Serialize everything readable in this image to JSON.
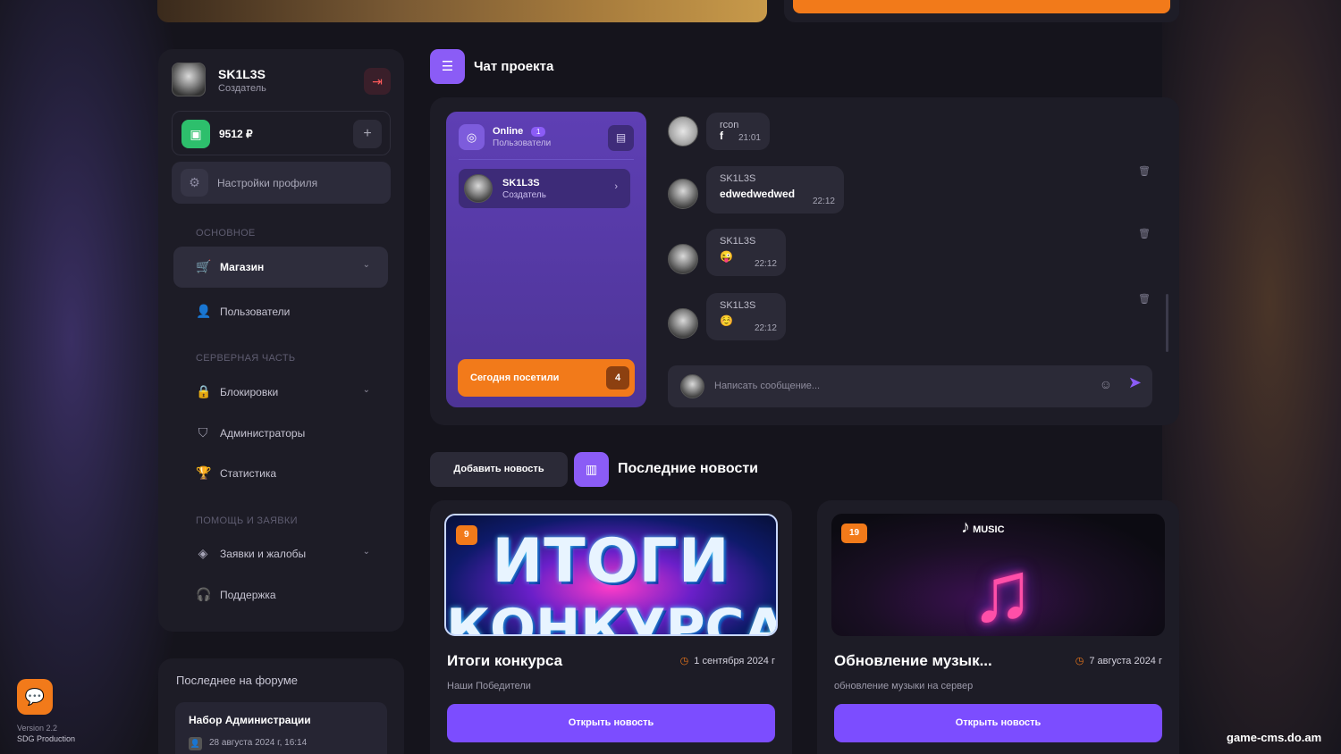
{
  "sidebar": {
    "user": {
      "name": "SK1L3S",
      "role": "Создатель"
    },
    "balance": "9512 ₽",
    "settings_label": "Настройки профиля",
    "sections": [
      {
        "title": "ОСНОВНОЕ"
      },
      {
        "title": "СЕРВЕРНАЯ ЧАСТЬ"
      },
      {
        "title": "ПОМОЩЬ И ЗАЯВКИ"
      }
    ],
    "items": [
      {
        "label": "Магазин",
        "icon": "cart-icon",
        "active": true
      },
      {
        "label": "Пользователи",
        "icon": "user-icon"
      },
      {
        "label": "Блокировки",
        "icon": "lock-icon"
      },
      {
        "label": "Администраторы",
        "icon": "shield-icon"
      },
      {
        "label": "Статистика",
        "icon": "trophy-icon"
      },
      {
        "label": "Заявки и жалобы",
        "icon": "layers-icon"
      },
      {
        "label": "Поддержка",
        "icon": "headset-icon"
      }
    ]
  },
  "forum": {
    "title": "Последнее на форуме",
    "post_title": "Набор Администрации",
    "post_date": "28 августа 2024 г, 16:14"
  },
  "chat": {
    "title": "Чат проекта",
    "online": {
      "label": "Online",
      "count": "1",
      "sub": "Пользователи"
    },
    "online_user": {
      "name": "SK1L3S",
      "role": "Создатель"
    },
    "visited": {
      "label": "Сегодня посетили",
      "count": "4"
    },
    "messages": [
      {
        "user": "rcon",
        "text": "f",
        "time": "21:01"
      },
      {
        "user": "SK1L3S",
        "text": "edwedwedwed",
        "time": "22:12"
      },
      {
        "user": "SK1L3S",
        "text": "😜",
        "time": "22:12"
      },
      {
        "user": "SK1L3S",
        "text": "☺️",
        "time": "22:12"
      }
    ],
    "input_placeholder": "Написать сообщение..."
  },
  "news": {
    "add_label": "Добавить новость",
    "title": "Последние новости",
    "cards": [
      {
        "badge": "9",
        "image_text": [
          "ИТОГИ",
          "КОНКУРСА"
        ],
        "title": "Итоги конкурса",
        "date": "1 сентября 2024 г",
        "subtitle": "Наши Победители",
        "button": "Открыть новость"
      },
      {
        "badge": "19",
        "image_logo": "MUSIC",
        "title": "Обновление музык...",
        "date": "7 августа 2024 г",
        "subtitle": "обновление музыки на сервер",
        "button": "Открыть новость"
      }
    ]
  },
  "footer": {
    "version": "Version 2.2",
    "production": "SDG Production",
    "watermark": "game-cms.do.am"
  },
  "colors": {
    "accent": "#8b5cf6",
    "orange": "#f27a1a",
    "panel": "#1d1c26",
    "bg": "#15141c"
  }
}
